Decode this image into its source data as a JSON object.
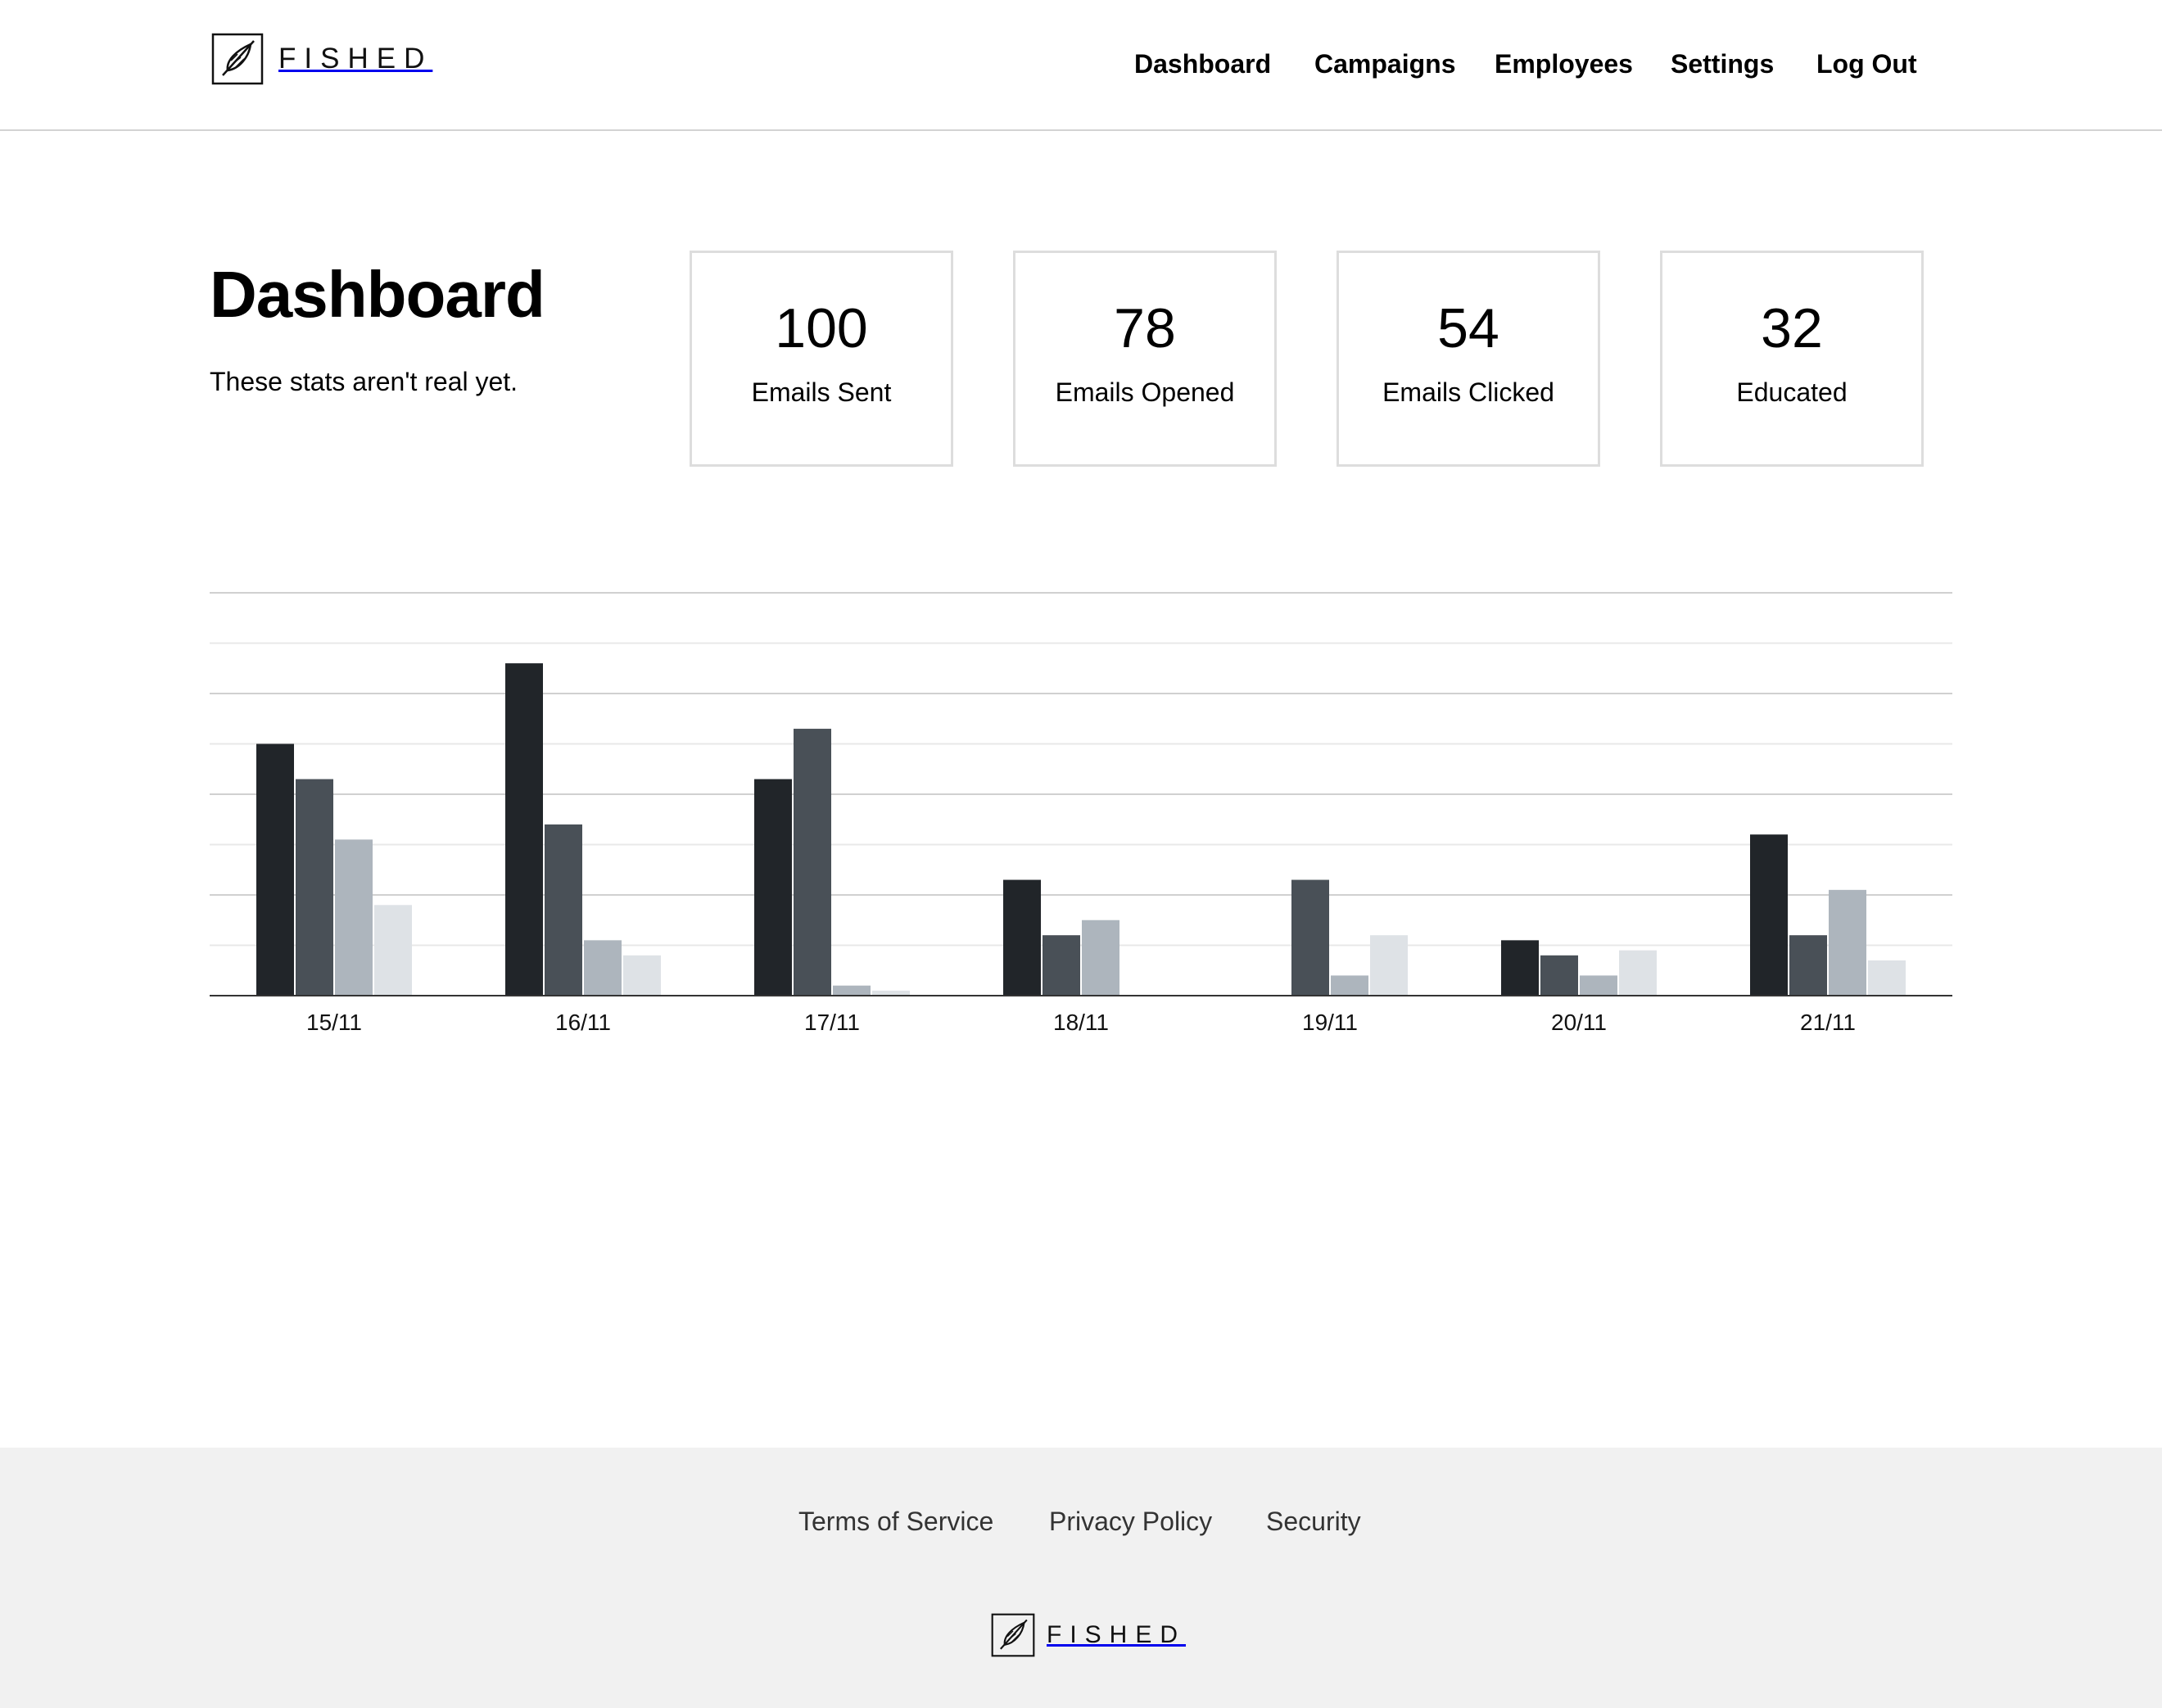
{
  "brand": {
    "name": "FISHED",
    "logo_icon": "feather-in-square-icon"
  },
  "nav": {
    "items": [
      {
        "label": "Dashboard"
      },
      {
        "label": "Campaigns"
      },
      {
        "label": "Employees"
      },
      {
        "label": "Settings"
      },
      {
        "label": "Log Out"
      }
    ]
  },
  "page": {
    "title": "Dashboard",
    "subtitle": "These stats aren't real yet."
  },
  "stats": [
    {
      "value": "100",
      "label": "Emails Sent"
    },
    {
      "value": "78",
      "label": "Emails Opened"
    },
    {
      "value": "54",
      "label": "Emails Clicked"
    },
    {
      "value": "32",
      "label": "Educated"
    }
  ],
  "chart_data": {
    "type": "bar",
    "categories": [
      "15/11",
      "16/11",
      "17/11",
      "18/11",
      "19/11",
      "20/11",
      "21/11"
    ],
    "series": [
      {
        "color": "#212529",
        "values": [
          50,
          66,
          43,
          23,
          0,
          11,
          32
        ]
      },
      {
        "color": "#495057",
        "values": [
          43,
          34,
          53,
          12,
          23,
          8,
          12
        ]
      },
      {
        "color": "#adb5bd",
        "values": [
          31,
          11,
          2,
          15,
          4,
          4,
          21
        ]
      },
      {
        "color": "#dee2e6",
        "values": [
          18,
          8,
          1,
          0,
          12,
          9,
          7
        ]
      }
    ],
    "ylim": [
      0,
      80
    ],
    "grid": true,
    "legend": "none",
    "xlabel": "",
    "ylabel": ""
  },
  "footer": {
    "links": [
      {
        "label": "Terms of Service"
      },
      {
        "label": "Privacy Policy"
      },
      {
        "label": "Security"
      }
    ]
  }
}
